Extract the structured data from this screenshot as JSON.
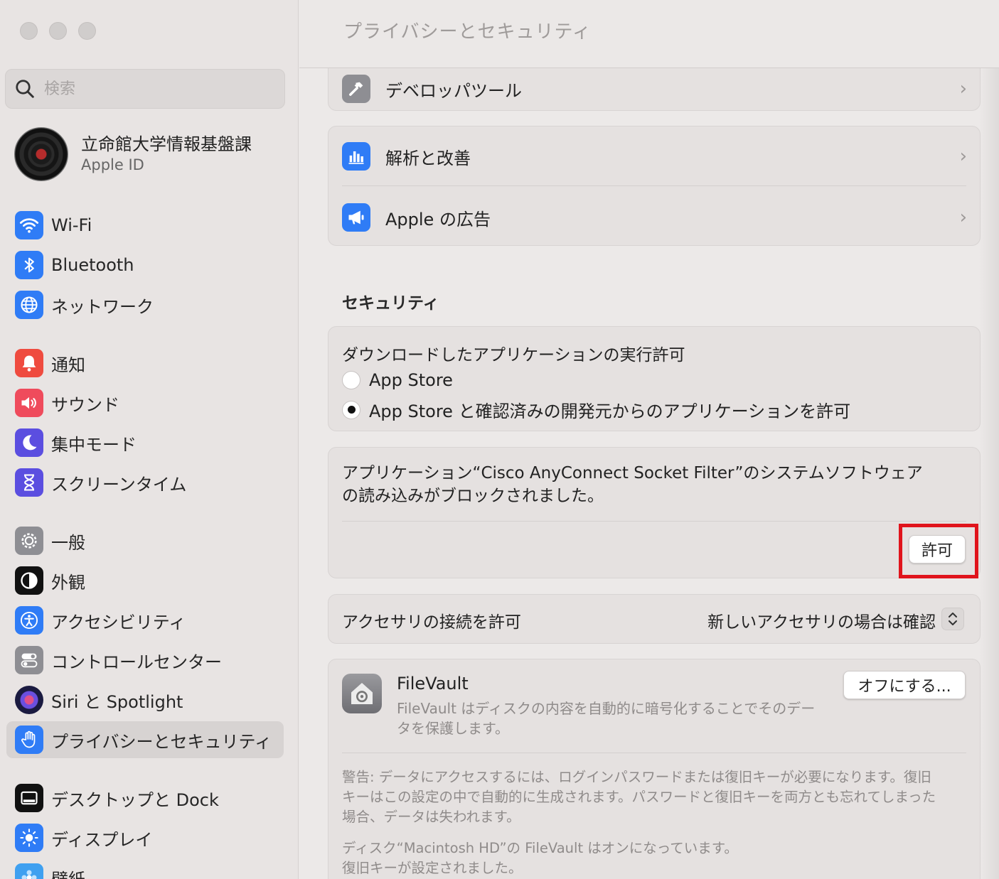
{
  "sidebar": {
    "search_placeholder": "検索",
    "account": {
      "name": "立命館大学情報基盤課",
      "subtitle": "Apple ID"
    },
    "items": [
      {
        "label": "Wi-Fi",
        "icon": "wifi-icon",
        "color": "#2f7cf6"
      },
      {
        "label": "Bluetooth",
        "icon": "bluetooth-icon",
        "color": "#2f7cf6"
      },
      {
        "label": "ネットワーク",
        "icon": "globe-icon",
        "color": "#2f7cf6"
      },
      {
        "label": "通知",
        "icon": "bell-icon",
        "color": "#ef4b3f"
      },
      {
        "label": "サウンド",
        "icon": "speaker-icon",
        "color": "#ef4b5c"
      },
      {
        "label": "集中モード",
        "icon": "moon-icon",
        "color": "#5b4ee0"
      },
      {
        "label": "スクリーンタイム",
        "icon": "hourglass-icon",
        "color": "#5b4ee0"
      },
      {
        "label": "一般",
        "icon": "gear-icon",
        "color": "#8e8e93"
      },
      {
        "label": "外観",
        "icon": "appearance-icon",
        "color": "#111111"
      },
      {
        "label": "アクセシビリティ",
        "icon": "accessibility-icon",
        "color": "#2f7cf6"
      },
      {
        "label": "コントロールセンター",
        "icon": "toggles-icon",
        "color": "#8e8e93"
      },
      {
        "label": "Siri と Spotlight",
        "icon": "siri-icon",
        "color": "#3a3a8c"
      },
      {
        "label": "プライバシーとセキュリティ",
        "icon": "hand-icon",
        "color": "#2f7cf6"
      },
      {
        "label": "デスクトップと Dock",
        "icon": "dock-icon",
        "color": "#111111"
      },
      {
        "label": "ディスプレイ",
        "icon": "sun-icon",
        "color": "#2f7cf6"
      },
      {
        "label": "壁紙",
        "icon": "wallpaper-icon",
        "color": "#3fa0f0"
      }
    ]
  },
  "main": {
    "title": "プライバシーとセキュリティ",
    "rows": {
      "developer_tools": "デベロッパツール",
      "analytics": "解析と改善",
      "apple_ads": "Apple の広告"
    },
    "security_heading": "セキュリティ",
    "download_card": {
      "heading": "ダウンロードしたアプリケーションの実行許可",
      "options": [
        {
          "label": "App Store",
          "selected": false
        },
        {
          "label": "App Store と確認済みの開発元からのアプリケーションを許可",
          "selected": true
        }
      ]
    },
    "blocked_card": {
      "message_line1": "アプリケーション“Cisco AnyConnect Socket Filter”のシステムソフトウェア",
      "message_line2": "の読み込みがブロックされました。",
      "allow_button": "許可"
    },
    "accessory_card": {
      "label": "アクセサリの接続を許可",
      "value": "新しいアクセサリの場合は確認"
    },
    "filevault_card": {
      "title": "FileVault",
      "description_line1": "FileVault はディスクの内容を自動的に暗号化することでそのデー",
      "description_line2": "タを保護します。",
      "button": "オフにする...",
      "warning_line1": "警告: データにアクセスするには、ログインパスワードまたは復旧キーが必要になります。復旧",
      "warning_line2": "キーはこの設定の中で自動的に生成されます。パスワードと復旧キーを両方とも忘れてしまった",
      "warning_line3": "場合、データは失われます。",
      "status_line1": "ディスク“Macintosh HD”の FileVault はオンになっています。",
      "status_line2": "復旧キーが設定されました。"
    },
    "highlight_color": "#e0141c"
  }
}
